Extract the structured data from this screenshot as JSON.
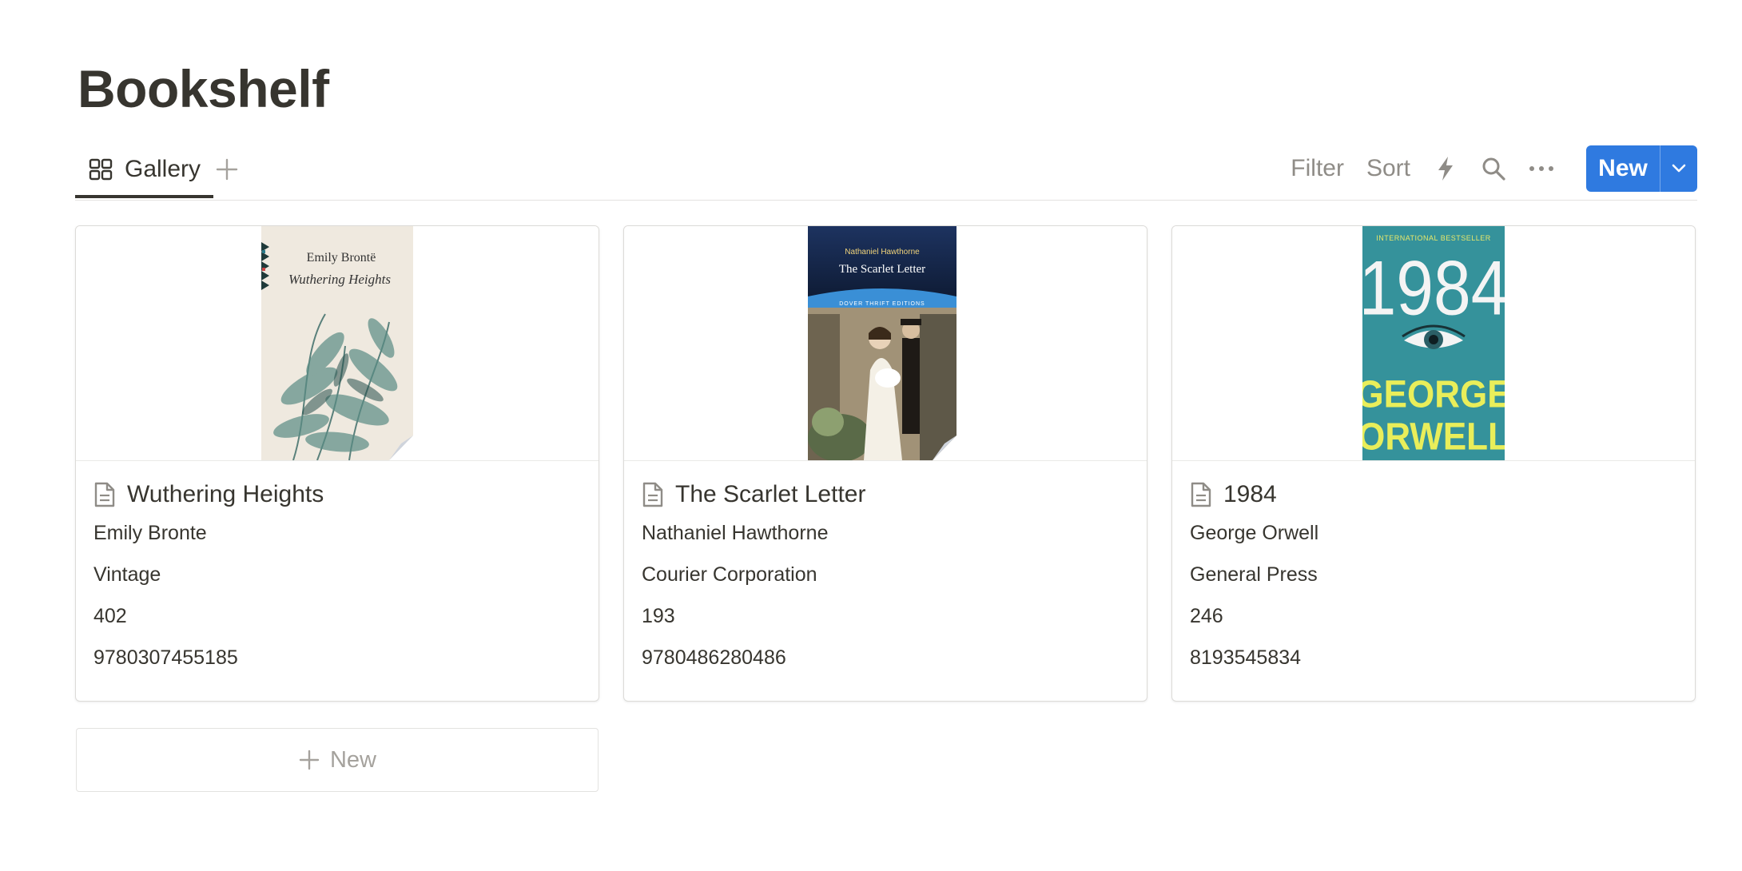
{
  "page": {
    "title": "Bookshelf"
  },
  "views": {
    "tabs": [
      {
        "label": "Gallery",
        "icon": "gallery-grid-icon",
        "active": true
      }
    ],
    "add_icon": "plus-icon"
  },
  "toolbar": {
    "filter_label": "Filter",
    "sort_label": "Sort",
    "automation_icon": "lightning-icon",
    "search_icon": "search-icon",
    "more_icon": "more-horizontal-icon",
    "new_label": "New",
    "new_dropdown_icon": "chevron-down-icon"
  },
  "colors": {
    "accent": "#2f7ae0",
    "text": "#37352f",
    "muted": "#8f8c87"
  },
  "cards": [
    {
      "title": "Wuthering Heights",
      "author": "Emily Bronte",
      "publisher": "Vintage",
      "pages": "402",
      "isbn": "9780307455185",
      "cover": {
        "author_text": "Emily Brontë",
        "title_text": "Wuthering Heights"
      }
    },
    {
      "title": "The Scarlet Letter",
      "author": "Nathaniel Hawthorne",
      "publisher": "Courier Corporation",
      "pages": "193",
      "isbn": "9780486280486",
      "cover": {
        "author_text": "Nathaniel Hawthorne",
        "title_text": "The Scarlet Letter",
        "series_text": "DOVER THRIFT EDITIONS"
      }
    },
    {
      "title": "1984",
      "author": "George Orwell",
      "publisher": "General Press",
      "pages": "246",
      "isbn": "8193545834",
      "cover": {
        "tagline_text": "INTERNATIONAL BESTSELLER",
        "title_text": "1984",
        "author_line1": "GEORGE",
        "author_line2": "ORWELL"
      }
    }
  ],
  "add_row": {
    "label": "New"
  }
}
